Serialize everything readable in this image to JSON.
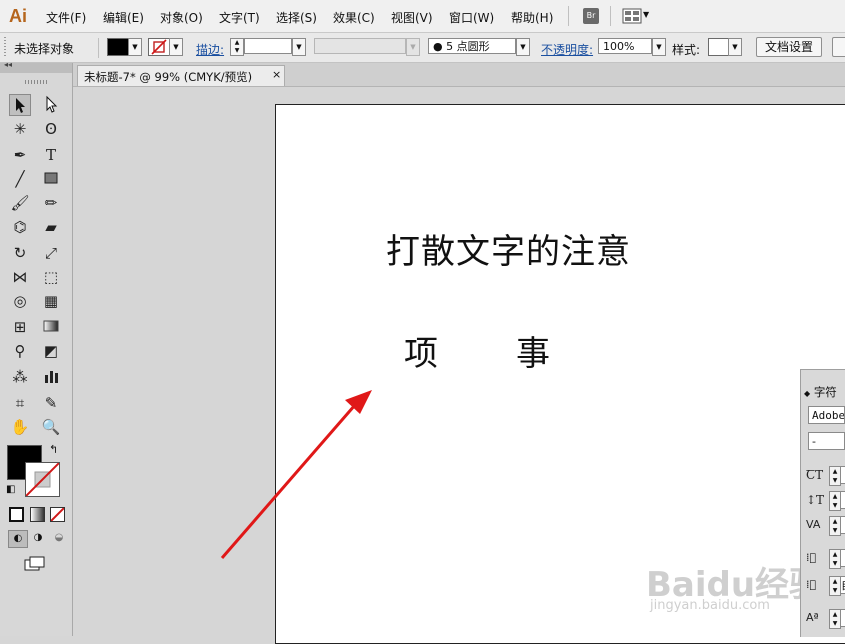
{
  "app": {
    "logo_text": "Ai"
  },
  "menu": [
    "文件(F)",
    "编辑(E)",
    "对象(O)",
    "文字(T)",
    "选择(S)",
    "效果(C)",
    "视图(V)",
    "窗口(W)",
    "帮助(H)"
  ],
  "menu_icons": {
    "bridge_label": "Br",
    "arrange": "arrange-documents-icon"
  },
  "control": {
    "selection_status": "未选择对象",
    "stroke_label": "描边:",
    "brush_value": "5 点圆形",
    "opacity_label": "不透明度:",
    "opacity_value": "100%",
    "style_label": "样式:",
    "doc_setup_button": "文档设置"
  },
  "document_tab": {
    "title": "未标题-7* @ 99% (CMYK/预览)",
    "close": "×"
  },
  "artboard": {
    "title_text": "打散文字的注意",
    "char_1": "项",
    "char_2": "事"
  },
  "char_panel": {
    "tab_label": "字符",
    "font_value": "Adobe",
    "style_value": "-",
    "leading_value": "自"
  },
  "watermark": {
    "main": "Baidu经验",
    "sub": "jingyan.baidu.com"
  },
  "colors": {
    "arrow": "#e01818",
    "fill_swatch": "#000000",
    "ai_logo": "#b5651d"
  }
}
